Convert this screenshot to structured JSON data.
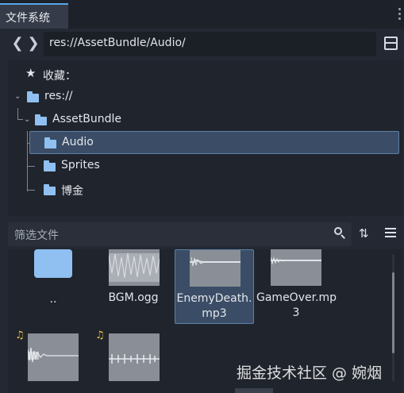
{
  "tab": {
    "label": "文件系统"
  },
  "nav": {
    "back_glyph": "❮",
    "forward_glyph": "❯"
  },
  "path": {
    "value": "res://AssetBundle/Audio/"
  },
  "tree": {
    "favorites_label": "收藏：",
    "root_label": "res://",
    "items": [
      {
        "label": "AssetBundle"
      },
      {
        "label": "Audio"
      },
      {
        "label": "Sprites"
      },
      {
        "label": "博金"
      }
    ]
  },
  "filter": {
    "placeholder": "筛选文件"
  },
  "files": [
    {
      "name": "..",
      "kind": "folder"
    },
    {
      "name": "BGM.ogg",
      "kind": "audio"
    },
    {
      "name": "EnemyDeath.\nmp3",
      "line1": "EnemyDeath.",
      "line2": "mp3",
      "kind": "audio",
      "selected": true
    },
    {
      "name": "GameOver.mp3",
      "line1": "GameOver.mp",
      "line2": "3",
      "kind": "audio"
    },
    {
      "name": "",
      "kind": "audio"
    },
    {
      "name": "",
      "kind": "audio"
    }
  ],
  "icons": {
    "favorite": "star-icon",
    "folder": "folder-icon",
    "search": "search-icon",
    "sort": "sort-icon",
    "list": "list-view-icon",
    "split": "split-view-icon",
    "audio": "music-note-icon"
  },
  "watermark": "掘金技术社区 @ 婉烟",
  "colors": {
    "accent": "#57a5e8",
    "folder": "#8fc0f1",
    "selection": "#3b4d66",
    "background": "#232833"
  }
}
